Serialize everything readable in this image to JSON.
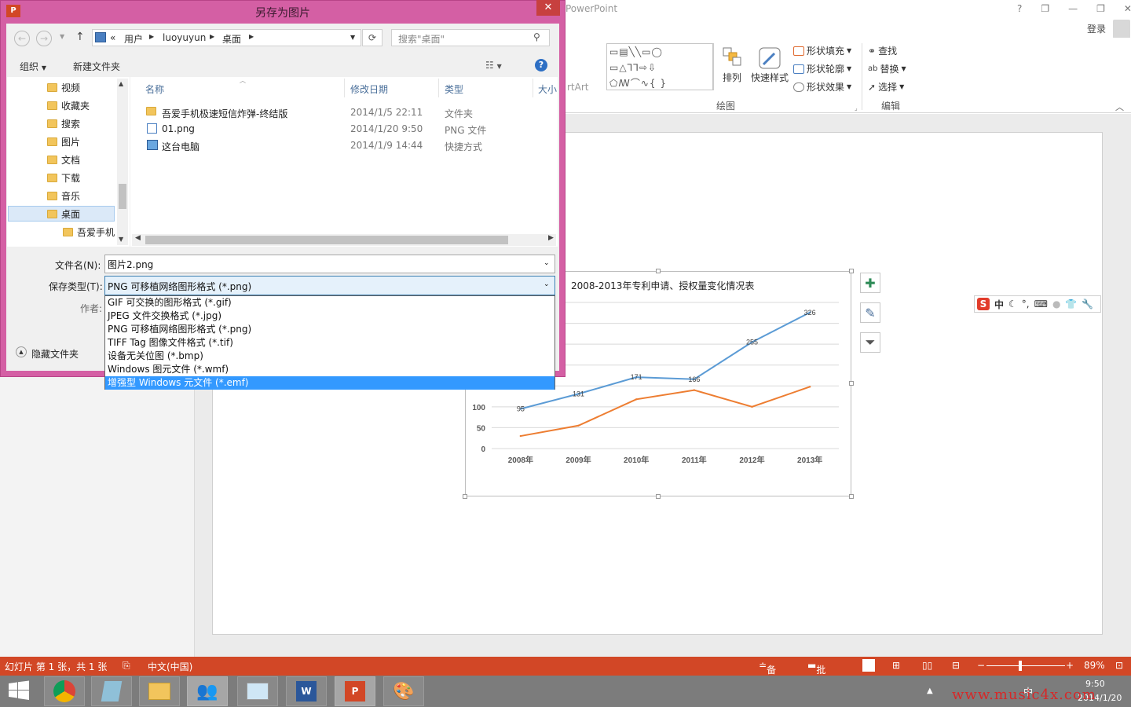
{
  "ppt": {
    "app_title": "PowerPoint",
    "window_controls": [
      "?",
      "❐",
      "—",
      "❐",
      "✕"
    ],
    "login": "登录",
    "ribbon": {
      "shapes_partial": "rtArt",
      "arrange": "排列",
      "quick_styles": "快速样式",
      "shape_fill": "形状填充",
      "shape_outline": "形状轮廓",
      "shape_effects": "形状效果",
      "find": "查找",
      "replace": "替换",
      "select": "选择",
      "group_draw": "绘图",
      "group_edit": "编辑"
    }
  },
  "dialog": {
    "title": "另存为图片",
    "breadcrumb": [
      "«",
      "用户",
      "luoyuyun",
      "桌面"
    ],
    "search_placeholder": "搜索\"桌面\"",
    "toolbar": {
      "organize": "组织",
      "new_folder": "新建文件夹"
    },
    "nav_items": [
      "视频",
      "收藏夹",
      "搜索",
      "图片",
      "文档",
      "下载",
      "音乐",
      "桌面",
      "吾爱手机"
    ],
    "columns": [
      "名称",
      "修改日期",
      "类型",
      "大小"
    ],
    "files": [
      {
        "name": "吾爱手机极速短信炸弹-终结版",
        "date": "2014/1/5 22:11",
        "type": "文件夹"
      },
      {
        "name": "01.png",
        "date": "2014/1/20 9:50",
        "type": "PNG 文件"
      },
      {
        "name": "这台电脑",
        "date": "2014/1/9 14:44",
        "type": "快捷方式"
      }
    ],
    "filename_label": "文件名(N):",
    "filename_value": "图片2.png",
    "savetype_label": "保存类型(T):",
    "savetype_value": "PNG 可移植网络图形格式 (*.png)",
    "author_label": "作者:",
    "hide_folders": "隐藏文件夹",
    "dropdown_options": [
      "GIF 可交换的图形格式 (*.gif)",
      "JPEG 文件交换格式 (*.jpg)",
      "PNG 可移植网络图形格式 (*.png)",
      "TIFF Tag 图像文件格式 (*.tif)",
      "设备无关位图 (*.bmp)",
      "Windows 图元文件 (*.wmf)",
      "增强型 Windows 元文件 (*.emf)"
    ],
    "dropdown_selected_index": 6
  },
  "chart_data": {
    "type": "line",
    "title": "2008-2013年专利申请、授权量变化情况表",
    "categories": [
      "2008年",
      "2009年",
      "2010年",
      "2011年",
      "2012年",
      "2013年"
    ],
    "series": [
      {
        "values": [
          95,
          131,
          171,
          166,
          255,
          326
        ],
        "color": "#5b9bd5",
        "labels": [
          "95",
          "131",
          "171",
          "166",
          "255",
          "326"
        ]
      },
      {
        "values": [
          30,
          55,
          118,
          140,
          100,
          148
        ],
        "color": "#ed7d31"
      }
    ],
    "y_ticks_visible": [
      "100",
      "50",
      "0"
    ],
    "ylim": [
      0,
      350
    ],
    "grid": true
  },
  "ime": {
    "chars": "中"
  },
  "statusbar": {
    "slide_info": "幻灯片 第 1 张，共 1 张",
    "language": "中文(中国)",
    "notes": "备注",
    "comments": "批注",
    "zoom": "89%"
  },
  "taskbar": {
    "time": "9:50",
    "date": "2014/1/20",
    "ime_indicator": "中",
    "watermark": "www.music4x.com"
  }
}
